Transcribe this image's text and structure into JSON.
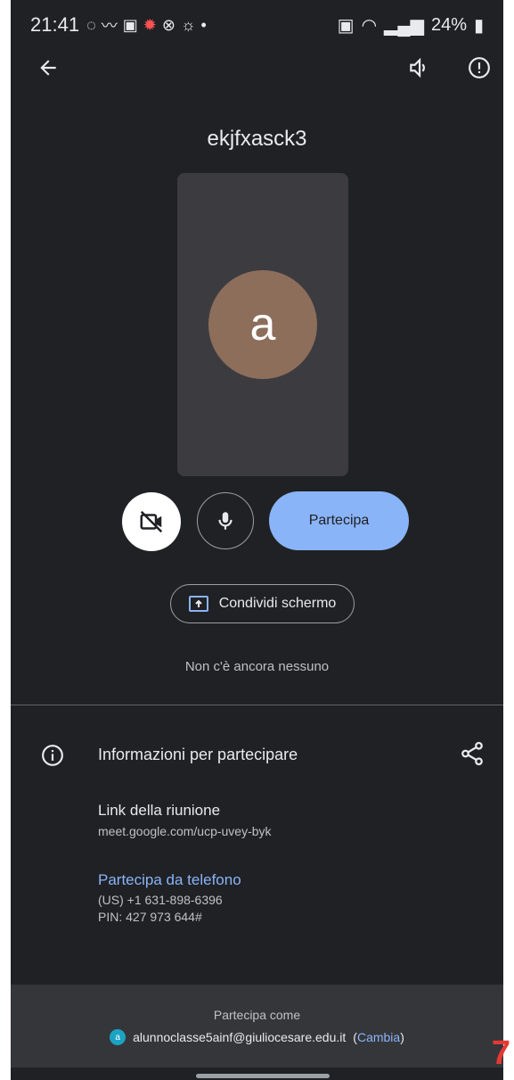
{
  "status_bar": {
    "time": "21:41",
    "battery": "24%"
  },
  "meeting": {
    "code": "ekjfxasck3",
    "avatar_letter": "a"
  },
  "controls": {
    "join_label": "Partecipa",
    "share_screen_label": "Condividi schermo"
  },
  "participants_text": "Non c'è ancora nessuno",
  "info": {
    "title": "Informazioni per partecipare",
    "link_title": "Link della riunione",
    "link_url": "meet.google.com/ucp-uvey-byk",
    "phone_title": "Partecipa da telefono",
    "phone_number": "(US) +1 631-898-6396",
    "pin": "PIN: 427 973 644#"
  },
  "join_as": {
    "label": "Partecipa come",
    "avatar_letter": "a",
    "email": "alunnoclasse5ainf@giuliocesare.edu.it",
    "change_label": "Cambia"
  },
  "page_number": "7",
  "colors": {
    "background": "#202124",
    "accent": "#8ab4f8",
    "avatar": "#8d6e5b"
  },
  "icons": [
    "back-arrow-icon",
    "speaker-icon",
    "report-icon",
    "camera-off-icon",
    "mic-icon",
    "present-icon",
    "info-icon",
    "share-icon"
  ]
}
